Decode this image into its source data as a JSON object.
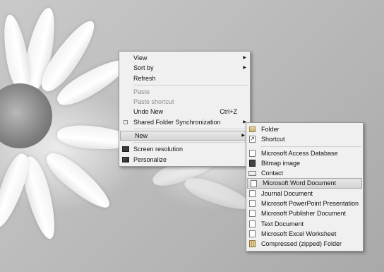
{
  "context_menu": {
    "items": [
      {
        "label": "View",
        "submenu": true
      },
      {
        "label": "Sort by",
        "submenu": true
      },
      {
        "label": "Refresh"
      },
      {
        "label": "Paste",
        "disabled": true
      },
      {
        "label": "Paste shortcut",
        "disabled": true
      },
      {
        "label": "Undo New",
        "shortcut": "Ctrl+Z"
      },
      {
        "label": "Shared Folder Synchronization",
        "submenu": true,
        "icon": "sync-icon"
      },
      {
        "label": "New",
        "submenu": true,
        "highlighted": true
      },
      {
        "label": "Screen resolution",
        "icon": "monitor-icon"
      },
      {
        "label": "Personalize",
        "icon": "personalize-icon"
      }
    ]
  },
  "new_submenu": {
    "items": [
      {
        "label": "Folder",
        "icon": "folder-icon"
      },
      {
        "label": "Shortcut",
        "icon": "shortcut-icon"
      },
      {
        "label": "Microsoft Access Database",
        "icon": "access-icon"
      },
      {
        "label": "Bitmap image",
        "icon": "bitmap-icon"
      },
      {
        "label": "Contact",
        "icon": "contact-icon"
      },
      {
        "label": "Microsoft Word Document",
        "icon": "word-icon",
        "highlighted": true
      },
      {
        "label": "Journal Document",
        "icon": "journal-icon"
      },
      {
        "label": "Microsoft PowerPoint Presentation",
        "icon": "powerpoint-icon"
      },
      {
        "label": "Microsoft Publisher Document",
        "icon": "publisher-icon"
      },
      {
        "label": "Text Document",
        "icon": "text-document-icon"
      },
      {
        "label": "Microsoft Excel Worksheet",
        "icon": "excel-icon"
      },
      {
        "label": "Compressed (zipped) Folder",
        "icon": "zip-folder-icon"
      }
    ]
  }
}
